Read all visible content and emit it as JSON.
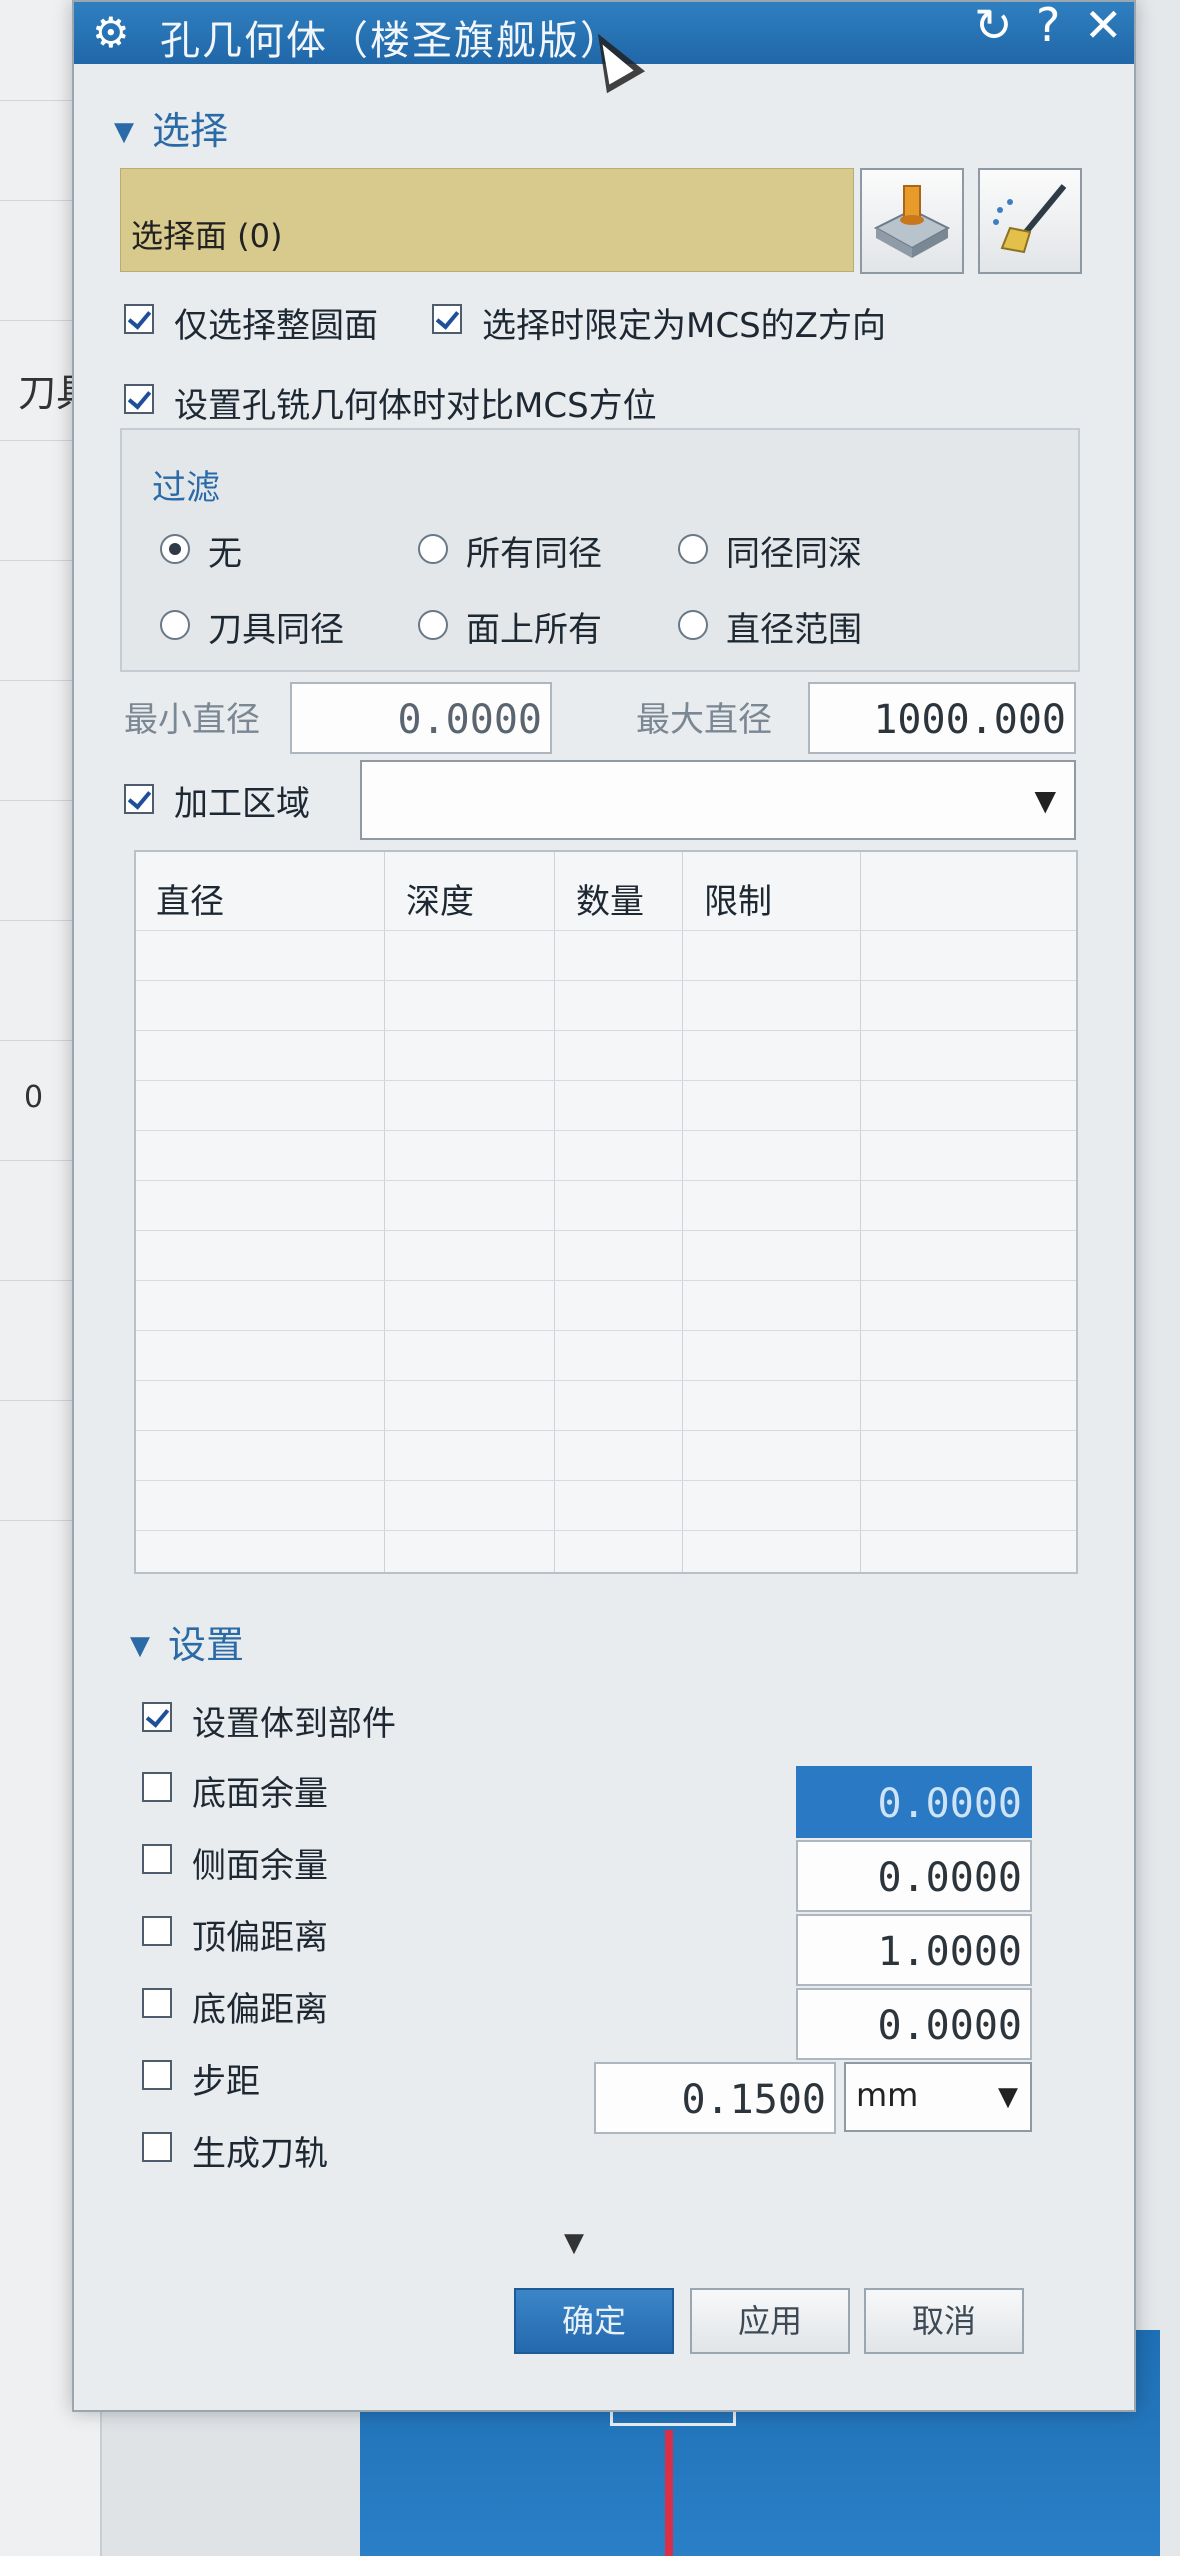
{
  "background": {
    "side_label": "刀具",
    "side_value": "0"
  },
  "dialog": {
    "title": "孔几何体（楼圣旗舰版）",
    "buttons": {
      "reset_icon": "refresh-icon",
      "help": "?",
      "close": "✕"
    }
  },
  "selection": {
    "header": "选择",
    "select_face": "选择面 (0)",
    "icons": [
      "select-hole-icon",
      "clear-brush-icon"
    ],
    "only_full_circle": {
      "label": "仅选择整圆面",
      "checked": true
    },
    "limit_mcs_z": {
      "label": "选择时限定为MCS的Z方向",
      "checked": true
    },
    "compare_mcs": {
      "label": "设置孔铣几何体时对比MCS方位",
      "checked": true
    }
  },
  "filter": {
    "title": "过滤",
    "options": [
      {
        "label": "无",
        "selected": true
      },
      {
        "label": "所有同径",
        "selected": false
      },
      {
        "label": "同径同深",
        "selected": false
      },
      {
        "label": "刀具同径",
        "selected": false
      },
      {
        "label": "面上所有",
        "selected": false
      },
      {
        "label": "直径范围",
        "selected": false
      }
    ],
    "min_diameter_label": "最小直径",
    "min_diameter": "0.0000",
    "max_diameter_label": "最大直径",
    "max_diameter": "1000.000"
  },
  "machining_area": {
    "label": "加工区域",
    "checked": true,
    "value": ""
  },
  "table": {
    "columns": [
      "直径",
      "深度",
      "数量",
      "限制"
    ],
    "rows": []
  },
  "settings": {
    "header": "设置",
    "items": [
      {
        "label": "设置体到部件",
        "checked": true
      },
      {
        "label": "底面余量",
        "checked": false,
        "value": "0.0000"
      },
      {
        "label": "侧面余量",
        "checked": false,
        "value": "0.0000"
      },
      {
        "label": "顶偏距离",
        "checked": false,
        "value": "1.0000"
      },
      {
        "label": "底偏距离",
        "checked": false,
        "value": "0.0000"
      },
      {
        "label": "步距",
        "checked": false,
        "value": "0.1500",
        "unit": "mm"
      },
      {
        "label": "生成刀轨",
        "checked": false
      }
    ]
  },
  "footer": {
    "ok": "确定",
    "apply": "应用",
    "cancel": "取消"
  }
}
